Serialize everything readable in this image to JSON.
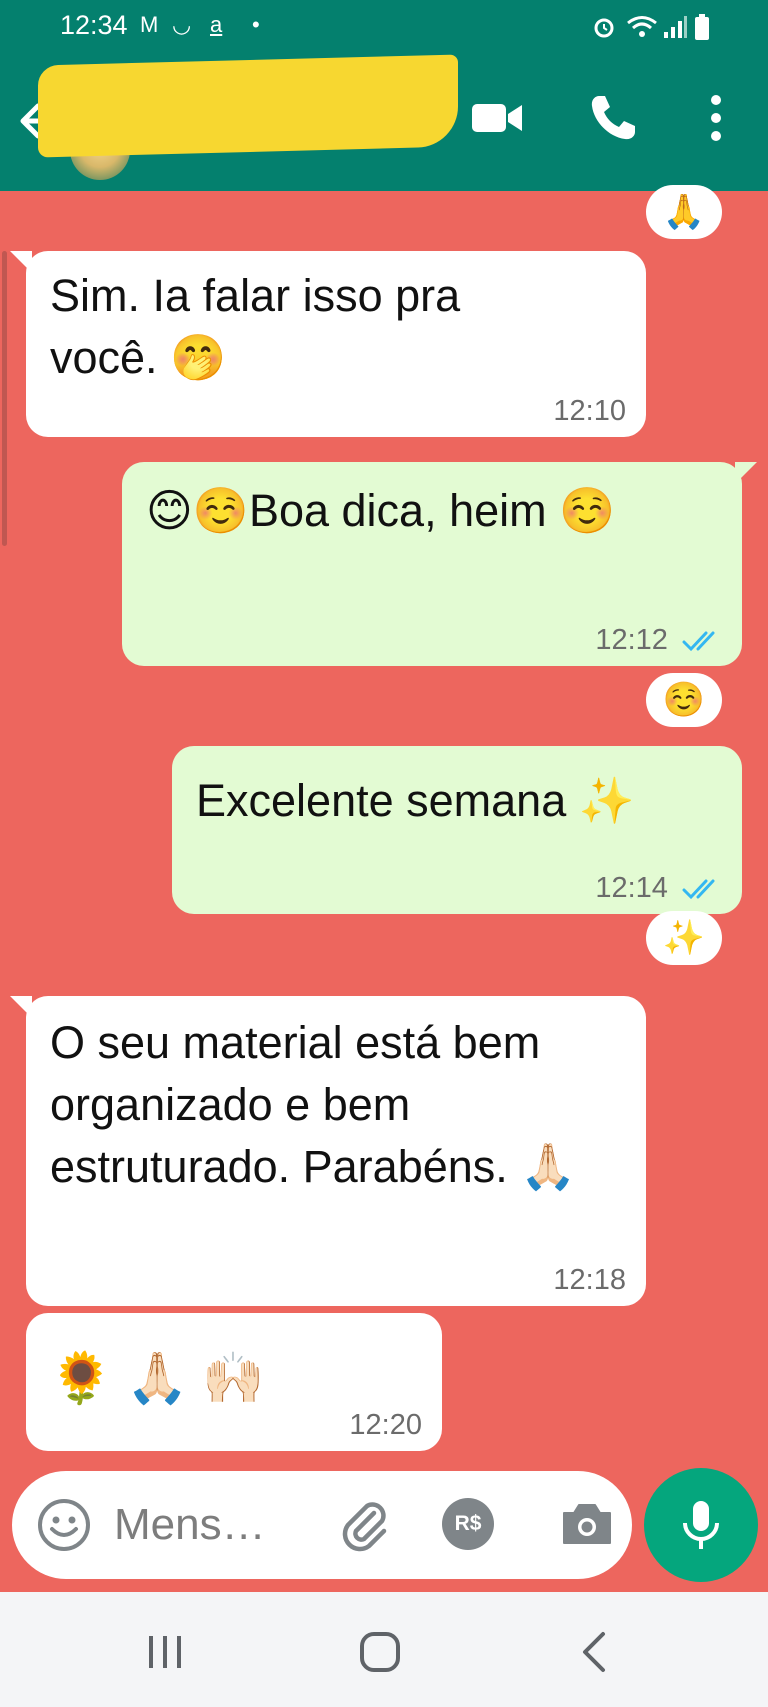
{
  "status_bar": {
    "time": "12:34",
    "notifications": [
      "M",
      "◡",
      "a",
      "•"
    ],
    "right_icons": [
      "alarm-icon",
      "wifi-icon",
      "signal-icon",
      "battery-icon"
    ]
  },
  "app_bar": {
    "contact_name": "",
    "icons": [
      "back-arrow-icon",
      "avatar",
      "video-call-icon",
      "voice-call-icon",
      "menu-icon"
    ],
    "background_color": "#04806e"
  },
  "chat": {
    "background_color": "#ed665e",
    "top_reaction": "🙏",
    "messages": [
      {
        "direction": "in",
        "text": "Sim. Ia falar isso pra você. 🤭",
        "time": "12:10"
      },
      {
        "direction": "out",
        "text": "😊☺️Boa dica, heim ☺️",
        "time": "12:12",
        "status": "read",
        "reaction": "☺️"
      },
      {
        "direction": "out",
        "text": "Excelente semana ✨",
        "time": "12:14",
        "status": "read",
        "reaction": "✨"
      },
      {
        "direction": "in",
        "text": "O seu material está bem organizado e bem estruturado. Parabéns. 🙏🏻",
        "time": "12:18"
      },
      {
        "direction": "in",
        "text": "🌻 🙏🏻 🙌🏻",
        "time": "12:20"
      }
    ],
    "read_tick_color": "#34b7f1"
  },
  "input_bar": {
    "placeholder": "Mens…",
    "pay_label": "R$",
    "icons": [
      "emoji-icon",
      "attach-icon",
      "payment-icon",
      "camera-icon",
      "mic-icon"
    ],
    "mic_color": "#05a67d"
  },
  "nav_bar": {
    "icons": [
      "recents-icon",
      "home-icon",
      "back-icon"
    ]
  }
}
